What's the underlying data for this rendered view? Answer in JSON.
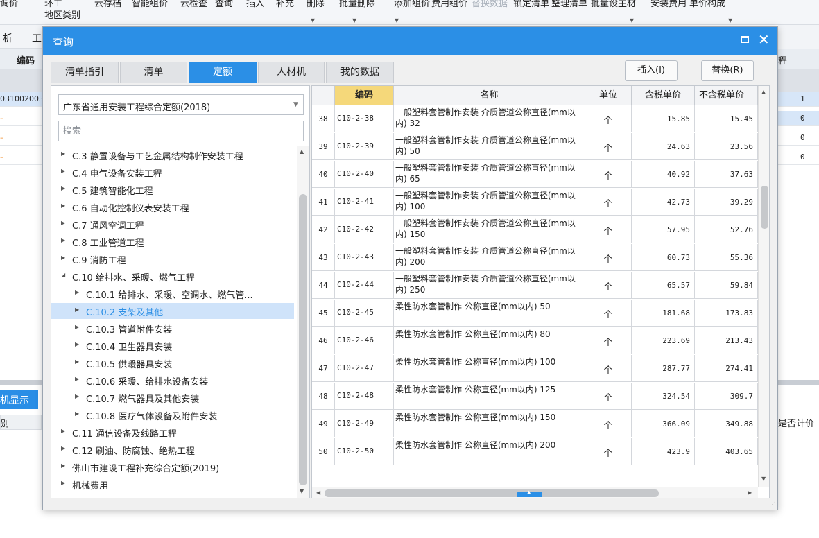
{
  "background": {
    "toolbar_row1": [
      "调价",
      "环工",
      "云存档",
      "智能组价",
      "云检查",
      "查询",
      "插入",
      "补充",
      "删除",
      "批量删除",
      "添加组价",
      "费用组价",
      "替换数据",
      "锁定清单",
      "整理清单",
      "批量设主材",
      "安装费用",
      "单价构成"
    ],
    "toolbar_row2": "地区类别",
    "tabs": [
      "析",
      "工"
    ],
    "header_code": "编码",
    "first_code": "031002003",
    "right_header": "程",
    "right_values": [
      "1",
      "0",
      "0",
      "0"
    ],
    "bottom_blue_button": "机显示",
    "bottom_left_label": "别",
    "bottom_right_label": "是否计价"
  },
  "dialog": {
    "title": "查询",
    "tabs": [
      {
        "label": "清单指引",
        "active": false
      },
      {
        "label": "清单",
        "active": false
      },
      {
        "label": "定额",
        "active": true
      },
      {
        "label": "人材机",
        "active": false
      },
      {
        "label": "我的数据",
        "active": false
      }
    ],
    "insert_label": "插入(I)",
    "replace_label": "替换(R)",
    "quota_select": "广东省通用安装工程综合定额(2018)",
    "search_placeholder": "搜索",
    "tree": [
      {
        "label": "C.3 静置设备与工艺金属结构制作安装工程",
        "level": 0,
        "expanded": false,
        "selected": false
      },
      {
        "label": "C.4 电气设备安装工程",
        "level": 0,
        "expanded": false,
        "selected": false
      },
      {
        "label": "C.5 建筑智能化工程",
        "level": 0,
        "expanded": false,
        "selected": false
      },
      {
        "label": "C.6 自动化控制仪表安装工程",
        "level": 0,
        "expanded": false,
        "selected": false
      },
      {
        "label": "C.7 通风空调工程",
        "level": 0,
        "expanded": false,
        "selected": false
      },
      {
        "label": "C.8 工业管道工程",
        "level": 0,
        "expanded": false,
        "selected": false
      },
      {
        "label": "C.9 消防工程",
        "level": 0,
        "expanded": false,
        "selected": false
      },
      {
        "label": "C.10 给排水、采暖、燃气工程",
        "level": 0,
        "expanded": true,
        "selected": false
      },
      {
        "label": "C.10.1 给排水、采暖、空调水、燃气管...",
        "level": 1,
        "expanded": false,
        "selected": false
      },
      {
        "label": "C.10.2 支架及其他",
        "level": 1,
        "expanded": false,
        "selected": true
      },
      {
        "label": "C.10.3 管道附件安装",
        "level": 1,
        "expanded": false,
        "selected": false
      },
      {
        "label": "C.10.4 卫生器具安装",
        "level": 1,
        "expanded": false,
        "selected": false
      },
      {
        "label": "C.10.5 供暖器具安装",
        "level": 1,
        "expanded": false,
        "selected": false
      },
      {
        "label": "C.10.6 采暖、给排水设备安装",
        "level": 1,
        "expanded": false,
        "selected": false
      },
      {
        "label": "C.10.7 燃气器具及其他安装",
        "level": 1,
        "expanded": false,
        "selected": false
      },
      {
        "label": "C.10.8 医疗气体设备及附件安装",
        "level": 1,
        "expanded": false,
        "selected": false
      },
      {
        "label": "C.11 通信设备及线路工程",
        "level": 0,
        "expanded": false,
        "selected": false
      },
      {
        "label": "C.12 刷油、防腐蚀、绝热工程",
        "level": 0,
        "expanded": false,
        "selected": false
      },
      {
        "label": "佛山市建设工程补充综合定额(2019)",
        "level": 0,
        "expanded": false,
        "selected": false
      },
      {
        "label": "机械费用",
        "level": 0,
        "expanded": false,
        "selected": false
      }
    ],
    "grid": {
      "columns": [
        "编码",
        "名称",
        "单位",
        "含税单价",
        "不含税单价"
      ],
      "rows": [
        {
          "idx": "38",
          "code": "C10-2-38",
          "name": "一般塑料套管制作安装 介质管道公称直径(mm以内) 32",
          "unit": "个",
          "p1": "15.85",
          "p2": "15.45"
        },
        {
          "idx": "39",
          "code": "C10-2-39",
          "name": "一般塑料套管制作安装 介质管道公称直径(mm以内) 50",
          "unit": "个",
          "p1": "24.63",
          "p2": "23.56"
        },
        {
          "idx": "40",
          "code": "C10-2-40",
          "name": "一般塑料套管制作安装 介质管道公称直径(mm以内) 65",
          "unit": "个",
          "p1": "40.92",
          "p2": "37.63"
        },
        {
          "idx": "41",
          "code": "C10-2-41",
          "name": "一般塑料套管制作安装 介质管道公称直径(mm以内) 100",
          "unit": "个",
          "p1": "42.73",
          "p2": "39.29"
        },
        {
          "idx": "42",
          "code": "C10-2-42",
          "name": "一般塑料套管制作安装 介质管道公称直径(mm以内) 150",
          "unit": "个",
          "p1": "57.95",
          "p2": "52.76"
        },
        {
          "idx": "43",
          "code": "C10-2-43",
          "name": "一般塑料套管制作安装 介质管道公称直径(mm以内) 200",
          "unit": "个",
          "p1": "60.73",
          "p2": "55.36"
        },
        {
          "idx": "44",
          "code": "C10-2-44",
          "name": "一般塑料套管制作安装 介质管道公称直径(mm以内) 250",
          "unit": "个",
          "p1": "65.57",
          "p2": "59.84"
        },
        {
          "idx": "45",
          "code": "C10-2-45",
          "name": "柔性防水套管制作 公称直径(mm以内) 50",
          "unit": "个",
          "p1": "181.68",
          "p2": "173.83"
        },
        {
          "idx": "46",
          "code": "C10-2-46",
          "name": "柔性防水套管制作 公称直径(mm以内) 80",
          "unit": "个",
          "p1": "223.69",
          "p2": "213.43"
        },
        {
          "idx": "47",
          "code": "C10-2-47",
          "name": "柔性防水套管制作 公称直径(mm以内) 100",
          "unit": "个",
          "p1": "287.77",
          "p2": "274.41"
        },
        {
          "idx": "48",
          "code": "C10-2-48",
          "name": "柔性防水套管制作 公称直径(mm以内) 125",
          "unit": "个",
          "p1": "324.54",
          "p2": "309.7"
        },
        {
          "idx": "49",
          "code": "C10-2-49",
          "name": "柔性防水套管制作 公称直径(mm以内) 150",
          "unit": "个",
          "p1": "366.09",
          "p2": "349.88"
        },
        {
          "idx": "50",
          "code": "C10-2-50",
          "name": "柔性防水套管制作 公称直径(mm以内) 200",
          "unit": "个",
          "p1": "423.9",
          "p2": "403.65"
        }
      ]
    }
  },
  "colors": {
    "accent": "#2b8fe6",
    "code_header": "#f5d87a",
    "selected_row": "#cfe3fa"
  }
}
